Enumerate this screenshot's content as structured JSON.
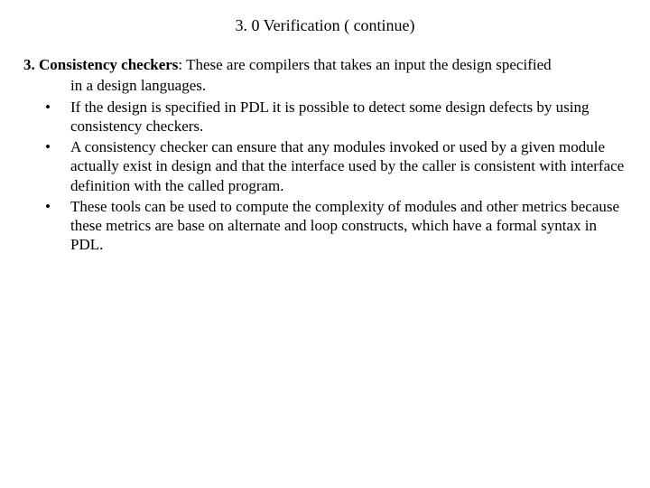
{
  "title": "3. 0 Verification ( continue)",
  "heading_lead": "3. Consistency checkers",
  "heading_rest": ": These are compilers that takes an input the design specified",
  "heading_cont": "in a design languages.",
  "bullets": {
    "b1": "If the design is specified in PDL it is possible to detect some design defects by using consistency checkers.",
    "b2": "A consistency checker can ensure that any modules invoked or used by a given module actually exist in design and that the interface used by the caller is consistent with interface definition with the called program.",
    "b3": "These tools can be used to compute the complexity of modules and other metrics because these metrics are base on alternate and loop constructs, which have a formal syntax in PDL."
  },
  "bullet_char": "•"
}
